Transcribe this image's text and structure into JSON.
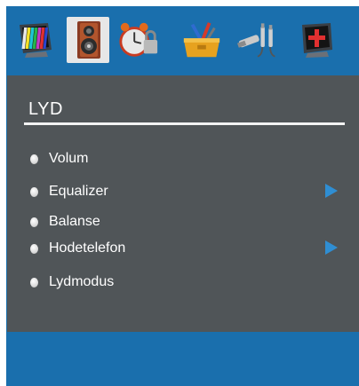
{
  "menu": {
    "title": "LYD",
    "items": [
      {
        "label": "Volum",
        "has_submenu": false
      },
      {
        "label": "Equalizer",
        "has_submenu": true
      },
      {
        "label": "Balanse",
        "has_submenu": false
      },
      {
        "label": "Hodetelefon",
        "has_submenu": true
      },
      {
        "label": "Lydmodus",
        "has_submenu": false
      }
    ]
  },
  "tabs": [
    {
      "icon": "picture-tv-icon",
      "selected": false
    },
    {
      "icon": "sound-speaker-icon",
      "selected": true
    },
    {
      "icon": "clock-lock-icon",
      "selected": false
    },
    {
      "icon": "settings-toolbox-icon",
      "selected": false
    },
    {
      "icon": "source-connector-icon",
      "selected": false
    },
    {
      "icon": "channel-install-icon",
      "selected": false
    }
  ],
  "colors": {
    "background": "#1a6fad",
    "panel": "#505558",
    "text": "#ffffff",
    "arrow": "#2f8ed3"
  }
}
